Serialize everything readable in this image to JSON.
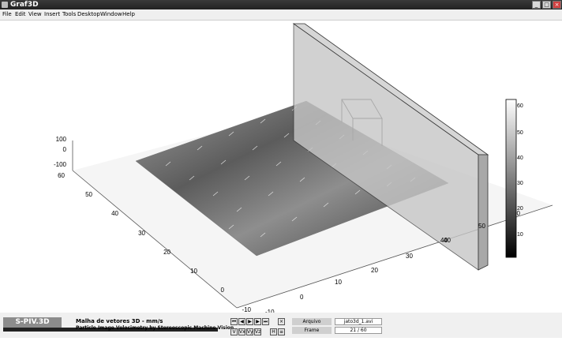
{
  "window": {
    "title": "Graf3D"
  },
  "menu": [
    "File",
    "Edit",
    "View",
    "Insert",
    "Tools",
    "Desktop",
    "Window",
    "Help"
  ],
  "plot": {
    "z_ticks": [
      "100",
      "0",
      "-100"
    ],
    "y_ticks": [
      "60",
      "50",
      "40",
      "30",
      "20",
      "10",
      "0",
      "-10"
    ],
    "x_ticks": [
      "-10",
      "0",
      "10",
      "20",
      "30",
      "40",
      "50"
    ],
    "back_y_ticks": [
      "60",
      "50",
      "40"
    ],
    "colorbar_ticks": [
      "60",
      "50",
      "40",
      "30",
      "20",
      "10"
    ],
    "colorbar_range": [
      0,
      65
    ]
  },
  "footer": {
    "brand": "S-PIV.3D",
    "title_line": "Malha de vetores 3D   - mm/s",
    "subtitle_line": "Particle Image Velocimetry by Stereoscopic Machine Vision",
    "arquivo_label": "Arquivo",
    "arquivo_value": "jato3d_1.avi",
    "frame_label": "Frame",
    "frame_value": "21 / 60",
    "nav_top": [
      "⏮",
      "◀",
      "▶",
      "▶",
      "⏭"
    ],
    "close_glyph": "×",
    "view_buttons": [
      "V",
      "Vx",
      "Vy",
      "Vz"
    ],
    "extra_buttons": [
      "H",
      "≡"
    ]
  }
}
